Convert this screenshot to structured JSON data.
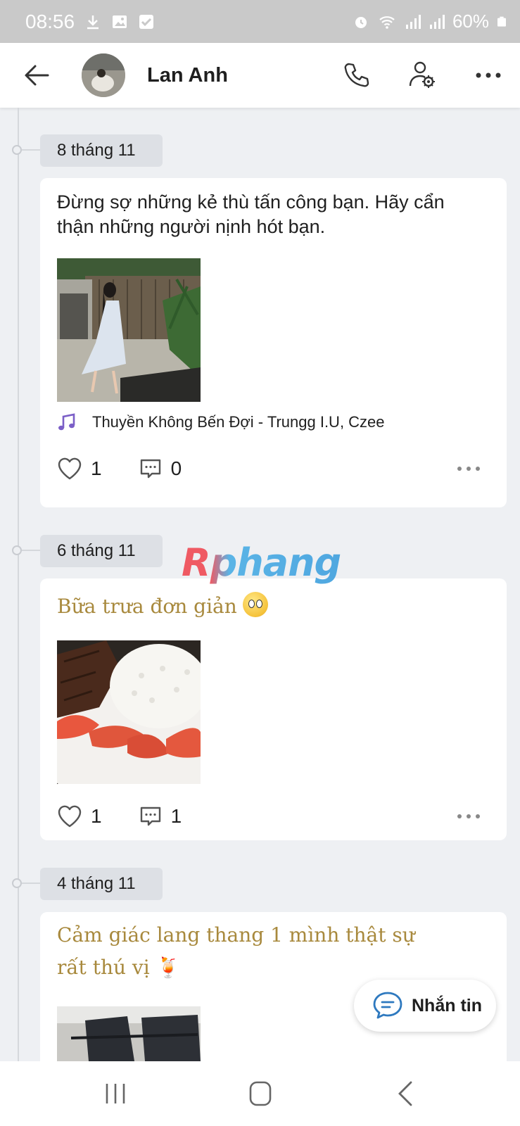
{
  "status_bar": {
    "time": "08:56",
    "battery": "60%"
  },
  "header": {
    "contact_name": "Lan Anh"
  },
  "posts": [
    {
      "date": "8 tháng 11",
      "text_line1": "Đừng sợ những kẻ thù tấn công bạn. Hãy cẩn",
      "text_line2": "thận những người nịnh hót bạn.",
      "music": "Thuyền Không Bến Đợi - Trungg I.U, Czee",
      "likes": "1",
      "comments": "0"
    },
    {
      "date": "6 tháng 11",
      "text_line1": "Bữa trưa đơn giản",
      "likes": "1",
      "comments": "1"
    },
    {
      "date": "4 tháng 11",
      "text_line1": "Cảm giác lang thang 1 mình thật sự",
      "text_line2": "rất thú vị 🍹"
    }
  ],
  "watermark": "Rphang",
  "message_button": {
    "label": "Nhắn tin"
  },
  "colors": {
    "accent_text": "#a8893d",
    "music_icon": "#7b5fc7"
  },
  "icons": [
    "back-arrow-icon",
    "phone-icon",
    "user-settings-icon",
    "more-icon",
    "heart-icon",
    "comment-icon",
    "music-note-icon",
    "chat-bubble-icon"
  ]
}
